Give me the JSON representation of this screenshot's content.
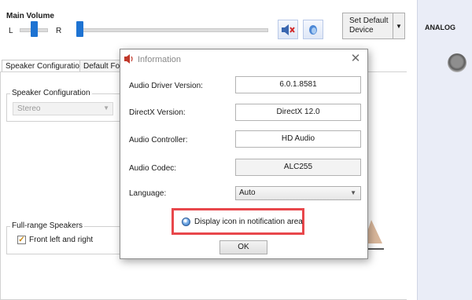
{
  "main_volume": {
    "title": "Main Volume",
    "left_label": "L",
    "right_label": "R",
    "mute_icon": "speaker-muted-icon",
    "balance_icon": "headphone-icon"
  },
  "set_default": {
    "label_line1": "Set Default",
    "label_line2": "Device"
  },
  "tabs": [
    {
      "label": "Speaker Configuration",
      "active": true
    },
    {
      "label": "Default Forn",
      "active": false
    }
  ],
  "speaker_config": {
    "group_title": "Speaker Configuration",
    "selected": "Stereo"
  },
  "full_range": {
    "group_title": "Full-range Speakers",
    "checkbox_label": "Front left and right",
    "checked": true
  },
  "analog": {
    "label": "ANALOG",
    "jack_color": "#8e8e8e"
  },
  "dialog": {
    "title": "Information",
    "title_icon": "speaker-icon",
    "close_glyph": "✕",
    "rows": [
      {
        "label": "Audio Driver Version:",
        "value": "6.0.1.8581"
      },
      {
        "label": "DirectX Version:",
        "value": "DirectX 12.0"
      },
      {
        "label": "Audio Controller:",
        "value": "HD Audio"
      },
      {
        "label": "Audio Codec:",
        "value": "ALC255"
      }
    ],
    "language_label": "Language:",
    "language_value": "Auto",
    "notify_label": "Display icon in notification area",
    "ok_label": "OK",
    "highlight_color": "#e8474b"
  }
}
